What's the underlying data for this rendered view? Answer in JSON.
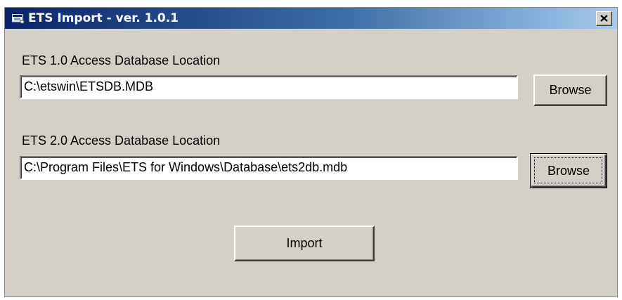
{
  "window": {
    "title": "ETS Import - ver. 1.0.1",
    "icon": "app-window-icon",
    "close_icon": "close-icon"
  },
  "ets1": {
    "label": "ETS 1.0 Access Database Location",
    "value": "C:\\etswin\\ETSDB.MDB",
    "browse_label": "Browse"
  },
  "ets2": {
    "label": "ETS 2.0 Access Database Location",
    "value": "C:\\Program Files\\ETS for Windows\\Database\\ets2db.mdb",
    "browse_label": "Browse"
  },
  "import_label": "Import",
  "colors": {
    "titlebar_start": "#0a246a",
    "titlebar_end": "#a6caf0",
    "face": "#d4d0c8"
  }
}
